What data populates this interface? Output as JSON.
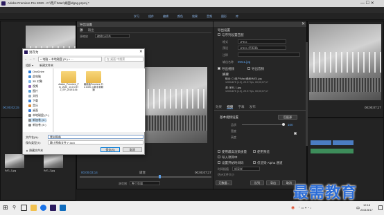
{
  "app": {
    "title": "Adobe Premiere Pro 2020 - C:\\用户\\Mac\\桌面\\dgng.prproj *",
    "workspaces": [
      "学习",
      "组件",
      "编辑",
      "颜色",
      "效果",
      "音频",
      "图形",
      "库"
    ]
  },
  "program_monitor": {
    "left_timecode": "00;00;02;15",
    "right_timecode": "00;00;07;17"
  },
  "timeline": {
    "clip_labels": [
      "IMG_1.jpg",
      "IMG_2.jpg",
      "IMG_3.jpg"
    ],
    "tab_label": "00;00;00;00"
  },
  "export_dialog": {
    "title": "导出设置",
    "tabs": [
      "源",
      "输出"
    ],
    "source_scaling_label": "源缩放",
    "source_scaling_value": "缩放以适合",
    "in_timecode": "00;00;03;14",
    "out_timecode": "00;00;07;17",
    "fit_label": "适合",
    "range_label": "源范围",
    "range_value": "整个剪辑",
    "timecodes_bottom": [
      "00;00;03;14",
      "00;00;07;17"
    ],
    "export_settings": {
      "header": "导出设置",
      "match_sequence_label": "与序列设置匹配",
      "format_label": "格式",
      "format_value": "JPEG",
      "preset_label": "预设",
      "preset_value": "JPEG (匹配源)",
      "comments_label": "注释",
      "output_name_label": "输出名称",
      "output_name_value": "IMG1.jpg",
      "export_video_label": "导出视频",
      "export_audio_label": "导出音频",
      "summary_label": "摘要",
      "summary_output": "输出: C:\\用户\\Mac\\桌面\\IMG1.jpg",
      "summary_output_detail": "1200x675 (1.0), 29.97 fps, 00;00;07;17",
      "summary_source": "源: 序列, 1.jpg",
      "summary_source_detail": "1200x675 (1.0), 29.97 fps, 00;00;07;17"
    },
    "settings_tabs": [
      "效果",
      "视频",
      "字幕",
      "发布"
    ],
    "basic_video": {
      "header": "基本视频设置",
      "quality_label": "品质",
      "quality_value": "100",
      "width_label": "宽度",
      "height_label": "高度",
      "match_source_button": "匹配源"
    },
    "bottom_options": {
      "max_render_quality": "使用最高渲染质量",
      "use_previews": "使用预览",
      "import_into_project": "导入项目中",
      "set_start_timecode": "设置开始时间码",
      "render_alpha_only": "仅渲染 Alpha 通道",
      "interpolation_label": "时间插值",
      "interpolation_value": "帧采样",
      "file_size_label": "估计文件大小"
    },
    "buttons": {
      "metadata": "元数据...",
      "queue": "队列",
      "export": "导出",
      "cancel": "取消"
    }
  },
  "save_as": {
    "title": "另存为",
    "breadcrumb": "« 电脑 > 本地磁盘 (D:) > ...",
    "search_placeholder": "在 桌面 中搜索",
    "organize_label": "组织 ▾",
    "new_folder_label": "新建文件夹",
    "nav_items": [
      "OneDrive",
      "此电脑",
      "3D 对象",
      "视频",
      "图片",
      "文档",
      "下载",
      "音乐",
      "桌面",
      "本地磁盘 (C:)",
      "新加卷 (D:)",
      "新加卷 (E:)"
    ],
    "files": [
      {
        "name": "Adobe_Premiere_Pro_2020_14.0.0.572_SP_20191106"
      },
      {
        "name": "最新版Premiere Pro 2020 从新手到精通"
      }
    ],
    "filename_label": "文件名(N):",
    "filename_value": "素材图像",
    "type_label": "保存类型(T):",
    "type_value": "静止图像文件 (*.jpg)",
    "hide_folders": "▲ 隐藏文件夹",
    "save_button": "保存(S)",
    "cancel_button": "取消"
  },
  "taskbar": {
    "time": "12:18",
    "date": "2021/5/17",
    "ime": "中",
    "search_hint": "在这里输入你要搜索的内容"
  },
  "watermark": "最需教育",
  "colors": {
    "accent_blue": "#5c9fe8",
    "panel": "#232323",
    "dialog": "#262626",
    "watermark": "#2b6cd6"
  }
}
